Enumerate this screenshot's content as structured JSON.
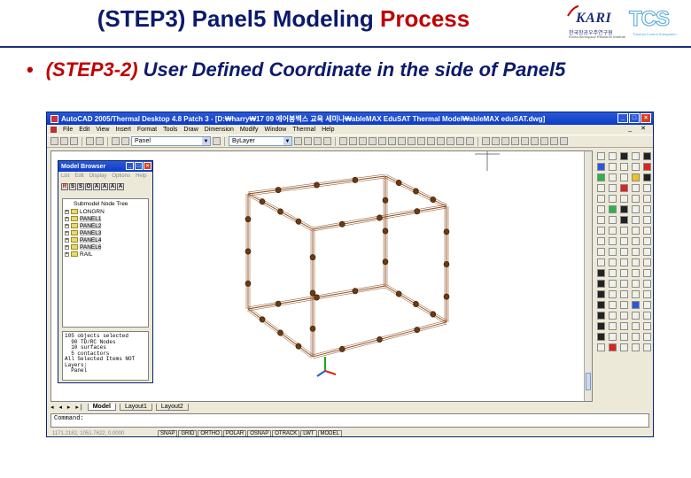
{
  "slide": {
    "title_prefix": "(STEP3) Panel5 Modeling",
    "title_accent": "Process",
    "bullet_step": "(STEP3-2)",
    "bullet_text": "User Defined Coordinate in the side of Panel5",
    "logo_kari": "KARI",
    "logo_kari_sub": "한국항공우주연구원",
    "logo_kari_sub2": "Korea Aerospace Research Institute",
    "logo_tcs": "TCS",
    "logo_tcs_sub": "Thermal Control Subsystem"
  },
  "window": {
    "title": "AutoCAD 2005/Thermal Desktop 4.8 Patch 3 - [D:₩harry₩17 09 에어봉백스 교육 세미나₩ableMAX EduSAT Thermal Model₩ableMAX eduSAT.dwg]",
    "minimize": "_",
    "maximize": "□",
    "close": "×",
    "mdi_buttons": "_ ✕"
  },
  "menu": [
    "File",
    "Edit",
    "View",
    "Insert",
    "Format",
    "Tools",
    "Draw",
    "Dimension",
    "Modify",
    "Window",
    "Thermal",
    "Help"
  ],
  "toolbar": {
    "layer_value": "Panel",
    "color_value": "ByLayer"
  },
  "model_browser": {
    "title": "Model Browser",
    "menu": [
      "List",
      "Edit",
      "Display",
      "Options",
      "Help"
    ],
    "tools": [
      "R",
      "S",
      "S",
      "O",
      "A",
      "A",
      "A",
      "A"
    ],
    "tree_header": "Submodel Node Tree",
    "nodes": [
      {
        "label": "LONGRN",
        "selected": false
      },
      {
        "label": "PANEL1",
        "selected": true
      },
      {
        "label": "PANEL2",
        "selected": true
      },
      {
        "label": "PANEL3",
        "selected": true
      },
      {
        "label": "PANEL4",
        "selected": true
      },
      {
        "label": "PANEL6",
        "selected": true
      },
      {
        "label": "RAIL",
        "selected": false
      }
    ],
    "info": "105 objects selected\n  90 TD/RC Nodes\n  10 surfaces\n  5 contactors\nAll Selected Items NOT\nLayers:\n  Panel"
  },
  "tabs": {
    "nav": "◂ ◂ ▸ ▸|",
    "model": "Model",
    "layout1": "Layout1",
    "layout2": "Layout2"
  },
  "command": {
    "prompt": "Command:"
  },
  "status": {
    "coords": "1171.2182, 1051.7622, 0.0000",
    "buttons": [
      "SNAP",
      "GRID",
      "ORTHO",
      "POLAR",
      "OSNAP",
      "OTRACK",
      "LWT",
      "MODEL"
    ]
  },
  "colors": {
    "title_blue": "#0c1a6b",
    "accent_red": "#c00000",
    "wireframe": "#8b4513",
    "node_fill": "#6b3a12"
  }
}
